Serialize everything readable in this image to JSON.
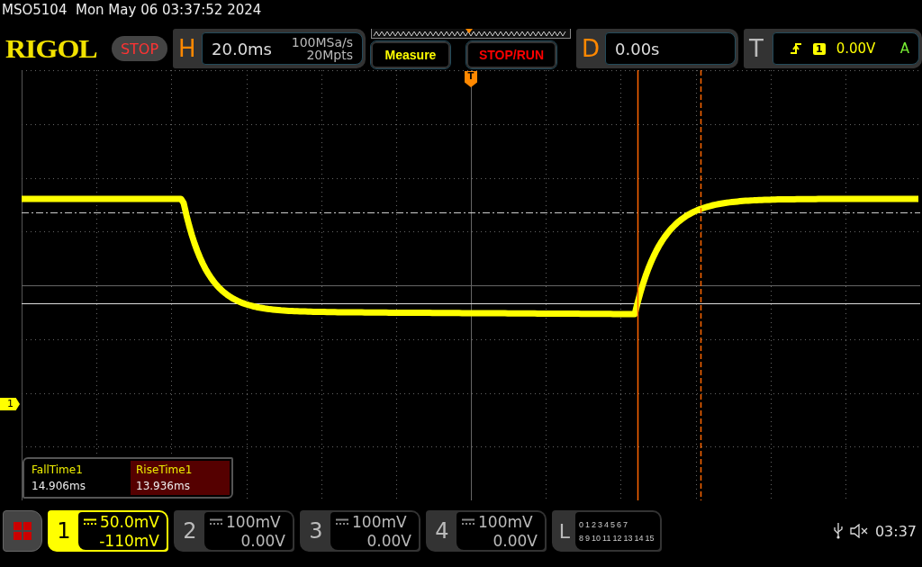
{
  "header": {
    "model": "MSO5104",
    "datetime": "Mon May 06 03:37:52 2024"
  },
  "logo": "RIGOL",
  "run_state": "STOP",
  "horizontal": {
    "label": "H",
    "timebase": "20.0ms",
    "sample_rate": "100MSa/s",
    "memory_depth": "20Mpts"
  },
  "buttons": [
    "Measure",
    "STOP/RUN"
  ],
  "delay": {
    "label": "D",
    "value": "0.00s"
  },
  "trigger": {
    "label": "T",
    "source": "1",
    "level": "0.00V",
    "mode": "A"
  },
  "trigger_marker": "T",
  "channel_marker": "1",
  "measurements": [
    {
      "name": "FallTime1",
      "value": "14.906ms",
      "selected": false
    },
    {
      "name": "RiseTime1",
      "value": "13.936ms",
      "selected": true
    }
  ],
  "channels": [
    {
      "number": "1",
      "scale": "50.0mV",
      "offset": "-110mV",
      "active": true
    },
    {
      "number": "2",
      "scale": "100mV",
      "offset": "0.00V",
      "active": false
    },
    {
      "number": "3",
      "scale": "100mV",
      "offset": "0.00V",
      "active": false
    },
    {
      "number": "4",
      "scale": "100mV",
      "offset": "0.00V",
      "active": false
    }
  ],
  "logic": {
    "label": "L",
    "row_1": [
      "0",
      "1",
      "2",
      "3",
      "4",
      "5",
      "6",
      "7"
    ],
    "row_2": [
      "8",
      "9",
      "10",
      "11",
      "12",
      "13",
      "14",
      "15"
    ]
  },
  "status": {
    "time": "03:37"
  }
}
